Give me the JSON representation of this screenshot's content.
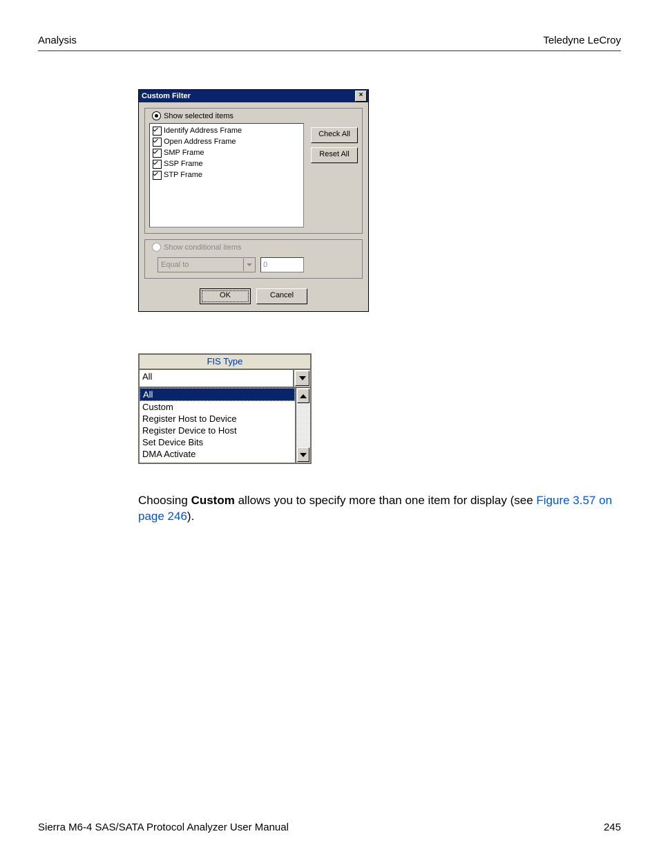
{
  "header": {
    "left": "Analysis",
    "right": "Teledyne LeCroy"
  },
  "dialog": {
    "title": "Custom Filter",
    "close_x": "✕",
    "radio_selected_label": "Show selected items",
    "radio_conditional_label": "Show conditional items",
    "items": [
      "Identify Address Frame",
      "Open Address Frame",
      "SMP Frame",
      "SSP Frame",
      "STP Frame"
    ],
    "btn_check_all": "Check All",
    "btn_reset_all": "Reset All",
    "cond_combo": "Equal to",
    "cond_value": "0",
    "btn_ok": "OK",
    "btn_cancel": "Cancel"
  },
  "fis": {
    "header": "FIS Type",
    "selected": "All",
    "options": [
      "All",
      "Custom",
      "Register Host to Device",
      "Register Device to Host",
      "Set Device Bits",
      "DMA Activate"
    ]
  },
  "paragraph": {
    "t1": "Choosing ",
    "bold": "Custom",
    "t2": " allows you to specify more than one item for display (see ",
    "link": "Figure 3.57 on page 246",
    "t3": ")."
  },
  "footer": {
    "left": "Sierra M6-4 SAS/SATA Protocol Analyzer User Manual",
    "right": "245"
  }
}
